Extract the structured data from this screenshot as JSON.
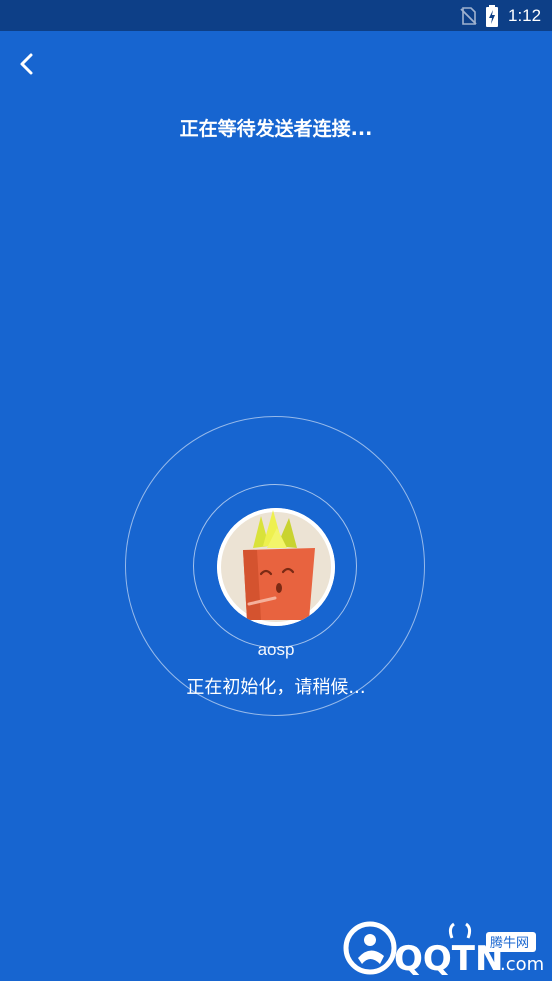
{
  "status_bar": {
    "time": "1:12",
    "icons": [
      "no-sim-icon",
      "battery-charging-icon"
    ]
  },
  "header": {
    "back_icon": "chevron-left-icon",
    "title": "正在等待发送者连接..."
  },
  "main": {
    "avatar_icon": "carrot-avatar-icon",
    "device_name": "aosp",
    "status": "正在初始化，请稍候..."
  },
  "watermark": {
    "badge": "腾牛网",
    "brand": "QQTN",
    "domain": ".com"
  },
  "colors": {
    "background": "#1765d0",
    "status_bar": "#0d3f87",
    "text": "#ffffff",
    "carrot": "#e8633f",
    "leaves": "#d9e23a"
  }
}
